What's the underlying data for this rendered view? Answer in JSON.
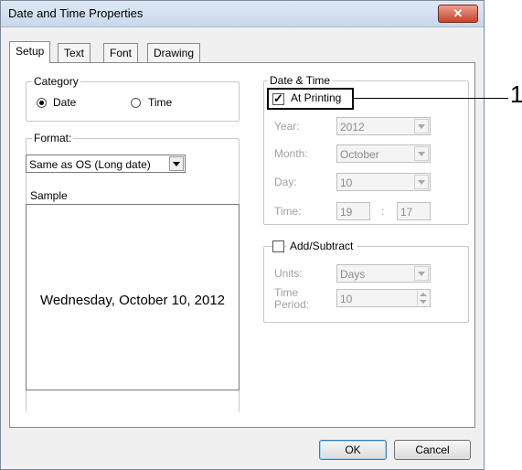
{
  "window": {
    "title": "Date and Time Properties",
    "close_label": "✕"
  },
  "tabs": [
    {
      "label": "Setup",
      "active": true
    },
    {
      "label": "Text"
    },
    {
      "label": "Font"
    },
    {
      "label": "Drawing"
    }
  ],
  "category": {
    "legend": "Category",
    "options": [
      {
        "label": "Date",
        "selected": true
      },
      {
        "label": "Time",
        "selected": false
      }
    ]
  },
  "format": {
    "legend": "Format:",
    "selected": "Same as OS (Long date)",
    "sample_label": "Sample",
    "sample_text": "Wednesday, October 10, 2012"
  },
  "date_time": {
    "legend": "Date & Time",
    "at_printing_label": "At Printing",
    "at_printing_checked": true,
    "year_label": "Year:",
    "year_value": "2012",
    "month_label": "Month:",
    "month_value": "October",
    "day_label": "Day:",
    "day_value": "10",
    "time_label": "Time:",
    "time_hour": "19",
    "time_sep": ":",
    "time_minute": "17"
  },
  "add_subtract": {
    "label": "Add/Subtract",
    "checked": false,
    "units_label": "Units:",
    "units_value": "Days",
    "period_label_1": "Time",
    "period_label_2": "Period:",
    "period_value": "10"
  },
  "buttons": {
    "ok": "OK",
    "cancel": "Cancel"
  },
  "callout": {
    "number": "1"
  }
}
